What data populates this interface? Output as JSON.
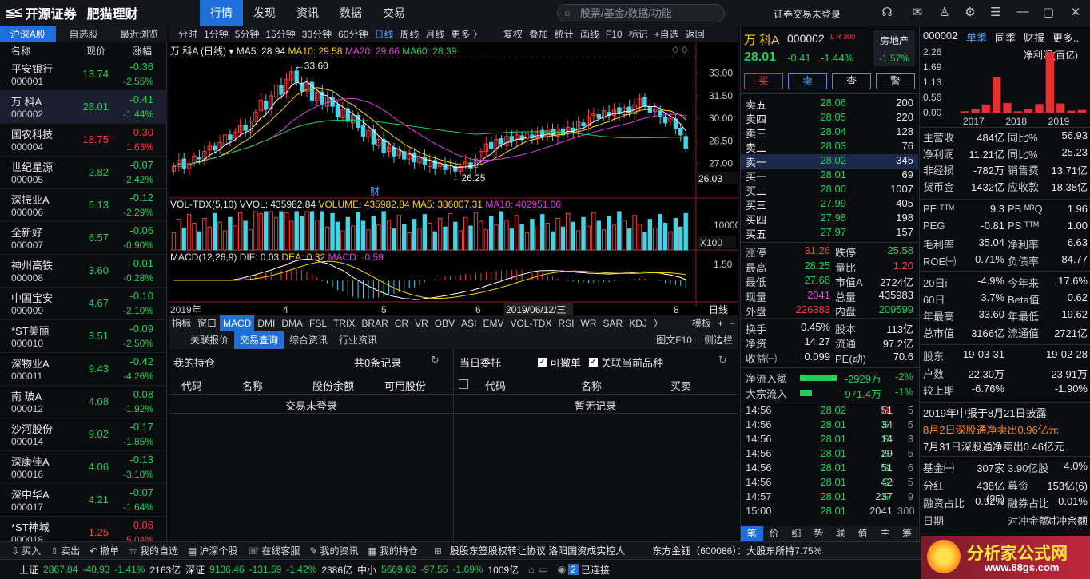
{
  "header": {
    "brand": "开源证券",
    "sub_brand": "肥猫理财",
    "nav": [
      "行情",
      "发现",
      "资讯",
      "数据",
      "交易"
    ],
    "active_nav": "行情",
    "search_placeholder": "股票/基金/数据/功能",
    "login_status": "证券交易未登录"
  },
  "left_panel": {
    "tabs": [
      "沪深A股",
      "自选股",
      "最近浏览"
    ],
    "columns": [
      "名称",
      "现价",
      "涨幅"
    ],
    "stocks": [
      {
        "name": "平安银行",
        "code": "000001",
        "price": "13.74",
        "change": "-0.36",
        "pct": "-2.55%"
      },
      {
        "name": "万 科A",
        "code": "000002",
        "price": "28.01",
        "change": "-0.41",
        "pct": "-1.44%"
      },
      {
        "name": "国农科技",
        "code": "000004",
        "price": "18.75",
        "change": "0.30",
        "pct": "1.63%"
      },
      {
        "name": "世纪星源",
        "code": "000005",
        "price": "2.82",
        "change": "-0.07",
        "pct": "-2.42%"
      },
      {
        "name": "深振业A",
        "code": "000006",
        "price": "5.13",
        "change": "-0.12",
        "pct": "-2.29%"
      },
      {
        "name": "全新好",
        "code": "000007",
        "price": "6.57",
        "change": "-0.06",
        "pct": "-0.90%"
      },
      {
        "name": "神州高铁",
        "code": "000008",
        "price": "3.60",
        "change": "-0.01",
        "pct": "-0.28%"
      },
      {
        "name": "中国宝安",
        "code": "000009",
        "price": "4.67",
        "change": "-0.10",
        "pct": "-2.10%"
      },
      {
        "name": "*ST美丽",
        "code": "000010",
        "price": "3.51",
        "change": "-0.09",
        "pct": "-2.50%"
      },
      {
        "name": "深物业A",
        "code": "000011",
        "price": "9.43",
        "change": "-0.42",
        "pct": "-4.26%"
      },
      {
        "name": "南 玻A",
        "code": "000012",
        "price": "4.08",
        "change": "-0.08",
        "pct": "-1.92%"
      },
      {
        "name": "沙河股份",
        "code": "000014",
        "price": "9.02",
        "change": "-0.17",
        "pct": "-1.85%"
      },
      {
        "name": "深康佳A",
        "code": "000016",
        "price": "4.06",
        "change": "-0.13",
        "pct": "-3.10%"
      },
      {
        "name": "深中华A",
        "code": "000017",
        "price": "4.21",
        "change": "-0.07",
        "pct": "-1.64%"
      },
      {
        "name": "*ST神城",
        "code": "000018",
        "price": "1.25",
        "change": "0.06",
        "pct": "5.04%"
      }
    ]
  },
  "chart_toolbar": {
    "periods": [
      "分时",
      "1分钟",
      "5分钟",
      "15分钟",
      "30分钟",
      "60分钟",
      "日线",
      "周线",
      "月线",
      "更多 〉"
    ],
    "active_period": "日线",
    "actions": [
      "复权",
      "叠加",
      "统计",
      "画线",
      "F10",
      "标记",
      "+自选",
      "返回"
    ]
  },
  "kline": {
    "title": "万 科A (日线)",
    "ma5": "MA5: 28.94",
    "ma10": "MA10: 29.58",
    "ma20": "MA20: 29.66",
    "ma60": "MA60: 28.39",
    "y_ticks": [
      "33.00",
      "31.50",
      "30.00",
      "28.50",
      "27.00"
    ],
    "last_label": "26.03",
    "high_label": "33.60",
    "low_label": "26.25",
    "fin_mark": "财",
    "vol_title": "VOL-TDX(5,10)",
    "vvol": "VVOL: 435982.84",
    "volume": "VOLUME: 435982.84",
    "vol_ma5": "MA5: 386007.31",
    "vol_ma10": "MA10: 402951.06",
    "vol_tick": "10000",
    "vol_unit": "X100",
    "macd_title": "MACD(12,26,9)",
    "dif": "DIF: 0.03",
    "dea": "DEA: 0.32",
    "macd": "MACD: -0.59",
    "macd_tick": "1.50",
    "x_labels": [
      "2019年",
      "4",
      "5",
      "6",
      "8"
    ],
    "cursor_date": "2019/06/12/三",
    "period_label": "日线"
  },
  "chart_data": {
    "type": "candlestick",
    "series_names": [
      "MA5",
      "MA10",
      "MA20",
      "MA60"
    ],
    "x_range": [
      "2019年",
      "8"
    ],
    "ylim": [
      25.5,
      34.2
    ],
    "y_ticks": [
      33.0,
      31.5,
      30.0,
      28.5,
      27.0
    ],
    "closes": [
      26.8,
      27.2,
      26.7,
      27.0,
      27.5,
      27.3,
      27.8,
      28.2,
      27.9,
      28.4,
      28.9,
      28.6,
      29.1,
      29.5,
      29.2,
      29.8,
      30.4,
      31.2,
      30.6,
      31.5,
      32.2,
      31.6,
      32.6,
      33.1,
      32.4,
      31.8,
      32.3,
      31.2,
      31.7,
      30.9,
      31.4,
      30.8,
      30.1,
      30.6,
      29.8,
      30.2,
      29.4,
      28.8,
      29.2,
      28.3,
      28.6,
      27.7,
      28.1,
      27.5,
      27.9,
      27.3,
      27.6,
      27.1,
      27.4,
      26.9,
      27.2,
      26.7,
      27.0,
      26.6,
      26.9,
      26.5,
      26.8,
      27.1,
      26.7,
      27.3,
      27.8,
      28.3,
      28.0,
      28.6,
      28.3,
      28.8,
      28.5,
      28.9,
      28.6,
      29.0,
      28.7,
      29.1,
      28.8,
      29.2,
      28.9,
      29.3,
      28.9,
      29.4,
      29.1,
      29.8,
      29.5,
      30.1,
      30.3,
      30.0,
      30.5,
      30.2,
      30.6,
      30.3,
      30.7,
      30.4,
      30.9,
      31.3,
      30.8,
      30.4,
      30.6,
      30.1,
      29.7,
      30.0,
      29.3,
      28.9,
      28.01
    ],
    "high": 33.6,
    "low": 26.25
  },
  "indicator_tabs": [
    "指标",
    "窗口",
    "MACD",
    "DMI",
    "DMA",
    "FSL",
    "TRIX",
    "BRAR",
    "CR",
    "VR",
    "OBV",
    "ASI",
    "EMV",
    "VOL-TDX",
    "RSI",
    "WR",
    "SAR",
    "KDJ",
    "〉",
    "模板",
    "+",
    "−"
  ],
  "active_indicator": "MACD",
  "bottom_tabs": [
    "关联报价",
    "交易查询",
    "综合资讯",
    "行业资讯"
  ],
  "active_bottom_tab": "交易查询",
  "bottom_tabs_right": [
    "图文F10",
    "侧边栏"
  ],
  "holdings": {
    "title": "我的持仓",
    "count": "共0条记录",
    "columns": [
      "代码",
      "名称",
      "股份余额",
      "可用股份"
    ],
    "empty": "交易未登录"
  },
  "entrust": {
    "title": "当日委托",
    "check1": "可撤单",
    "check2": "关联当前品种",
    "columns": [
      "代码",
      "名称",
      "买卖"
    ],
    "empty": "暂无记录"
  },
  "quote": {
    "name": "万 科A",
    "code": "000002",
    "tags": "L R 300",
    "sector": "房地产",
    "sector_pct": "-1.57%",
    "price": "28.01",
    "change": "-0.41",
    "pct": "-1.44%",
    "buttons": [
      "买",
      "卖",
      "查",
      "警"
    ],
    "asks": [
      {
        "label": "卖五",
        "price": "28.06",
        "vol": "200"
      },
      {
        "label": "卖四",
        "price": "28.05",
        "vol": "220"
      },
      {
        "label": "卖三",
        "price": "28.04",
        "vol": "128"
      },
      {
        "label": "卖二",
        "price": "28.03",
        "vol": "76"
      },
      {
        "label": "卖一",
        "price": "28.02",
        "vol": "345"
      }
    ],
    "bids": [
      {
        "label": "买一",
        "price": "28.01",
        "vol": "69"
      },
      {
        "label": "买二",
        "price": "28.00",
        "vol": "1007"
      },
      {
        "label": "买三",
        "price": "27.99",
        "vol": "405"
      },
      {
        "label": "买四",
        "price": "27.98",
        "vol": "198"
      },
      {
        "label": "买五",
        "price": "27.97",
        "vol": "157"
      }
    ],
    "stats": [
      {
        "l1": "涨停",
        "v1": "31.26",
        "c1": "red",
        "l2": "跌停",
        "v2": "25.58",
        "c2": "green"
      },
      {
        "l1": "最高",
        "v1": "28.25",
        "c1": "green",
        "l2": "量比",
        "v2": "1.20",
        "c2": "red"
      },
      {
        "l1": "最低",
        "v1": "27.68",
        "c1": "green",
        "l2": "市值A",
        "v2": "2724亿",
        "c2": "white"
      },
      {
        "l1": "现量",
        "v1": "2041",
        "c1": "mag",
        "l2": "总量",
        "v2": "435983",
        "c2": "white"
      },
      {
        "l1": "外盘",
        "v1": "226383",
        "c1": "red",
        "l2": "内盘",
        "v2": "209599",
        "c2": "green"
      },
      {
        "l1": "换手",
        "v1": "0.45%",
        "c1": "white",
        "l2": "股本",
        "v2": "113亿",
        "c2": "white"
      },
      {
        "l1": "净资",
        "v1": "14.27",
        "c1": "white",
        "l2": "流通",
        "v2": "97.2亿",
        "c2": "white"
      },
      {
        "l1": "收益㈠",
        "v1": "0.099",
        "c1": "white",
        "l2": "PE(动)",
        "v2": "70.6",
        "c2": "white"
      }
    ],
    "flows": [
      {
        "label": "净流入额",
        "value": "-2929万",
        "pct": "-2%",
        "bar": 0.62
      },
      {
        "label": "大宗流入",
        "value": "-971.4万",
        "pct": "-1%",
        "bar": 0.2
      }
    ],
    "ticks": [
      {
        "t": "14:56",
        "p": "28.02",
        "v": "51",
        "s": "B",
        "n": "5"
      },
      {
        "t": "14:56",
        "p": "28.01",
        "v": "34",
        "s": "S",
        "n": "5"
      },
      {
        "t": "14:56",
        "p": "28.01",
        "v": "14",
        "s": "S",
        "n": "3"
      },
      {
        "t": "14:56",
        "p": "28.01",
        "v": "29",
        "s": "S",
        "n": "5"
      },
      {
        "t": "14:56",
        "p": "28.01",
        "v": "51",
        "s": "S",
        "n": "6"
      },
      {
        "t": "14:56",
        "p": "28.01",
        "v": "42",
        "s": "S",
        "n": "5"
      },
      {
        "t": "14:57",
        "p": "28.01",
        "v": "237",
        "s": "S",
        "n": "9"
      },
      {
        "t": "15:00",
        "p": "28.01",
        "v": "2041",
        "s": "",
        "n": "300"
      }
    ],
    "bottom_tabs": [
      "笔",
      "价",
      "细",
      "势",
      "联",
      "值",
      "主",
      "筹"
    ]
  },
  "finance": {
    "code": "000002",
    "tabs": [
      "单季",
      "同季",
      "财报",
      "更多.."
    ],
    "chart_title": "净利润(百亿)",
    "y_ticks": [
      "2.26",
      "1.69",
      "1.13",
      "0.56",
      "0.00"
    ],
    "x_labels": [
      "2017",
      "2018",
      "2019"
    ],
    "bars": [
      0.05,
      0.12,
      0.3,
      1.32,
      0.36,
      0.05,
      0.15,
      0.32,
      2.26,
      0.34,
      0.07,
      0.1
    ],
    "rows1": [
      {
        "l1": "主营收",
        "v1": "484亿",
        "l2": "同比%",
        "v2": "56.93",
        "c2": "white"
      },
      {
        "l1": "净利润",
        "v1": "11.21亿",
        "l2": "同比%",
        "v2": "25.23",
        "c2": "white"
      },
      {
        "l1": "非经损",
        "v1": "-782万",
        "l2": "销售费",
        "v2": "13.71亿",
        "c2": "white"
      },
      {
        "l1": "货币金",
        "v1": "1432亿",
        "l2": "应收款",
        "v2": "18.38亿",
        "c2": "white"
      }
    ],
    "rows2": [
      {
        "l1": "PE ᵀᵀᴹ",
        "v1": "9.3",
        "l2": "PB ᴹᴿQ",
        "v2": "1.96"
      },
      {
        "l1": "PEG",
        "v1": "-0.81",
        "l2": "PS ᵀᵀᴹ",
        "v2": "1.00"
      },
      {
        "l1": "毛利率",
        "v1": "35.04",
        "l2": "净利率",
        "v2": "6.63"
      },
      {
        "l1": "ROE㈠",
        "v1": "0.71%",
        "l2": "负债率",
        "v2": "84.77"
      }
    ],
    "rows3": [
      {
        "l1": "20日i",
        "v1": "-4.9%",
        "l2": "今年来",
        "v2": "17.6%"
      },
      {
        "l1": "60日",
        "v1": "3.7%",
        "l2": "Beta值",
        "v2": "0.62"
      },
      {
        "l1": "年最高",
        "v1": "33.60",
        "l2": "年最低",
        "v2": "19.62"
      },
      {
        "l1": "总市值",
        "v1": "3166亿",
        "l2": "流通值",
        "v2": "2721亿"
      }
    ],
    "rows4": [
      {
        "l1": "股东",
        "v1": "19-03-31",
        "l2": "",
        "v2": "19-02-28"
      },
      {
        "l1": "户数",
        "v1": "22.30万",
        "l2": "",
        "v2": "23.91万"
      },
      {
        "l1": "较上期",
        "v1": "-6.76%",
        "l2": "",
        "v2": "-1.90%"
      }
    ],
    "news": [
      "2019年中报于8月21日披露",
      "8月2日深股通净卖出0.96亿元",
      "7月31日深股通净卖出0.46亿元"
    ],
    "rows5": [
      {
        "l1": "基金㈠",
        "v1": "307家",
        "l2": "3.90亿股",
        "v2": "4.0%"
      },
      {
        "l1": "分红",
        "v1": "438亿(25)",
        "l2": "募资",
        "v2": "153亿(6)"
      },
      {
        "l1": "融资占比",
        "v1": "0.92%",
        "l2": "融券占比",
        "v2": "0.01%"
      },
      {
        "l1": "日期",
        "v1": "",
        "l2": "对冲金额",
        "v2": "对冲余额"
      }
    ],
    "watermark": "分析家公式网",
    "watermark_url": "www.88gs.com"
  },
  "toolbar_bottom": [
    "买入",
    "卖出",
    "撤单",
    "我的自选",
    "沪深个股",
    "在线客服",
    "我的资讯",
    "我的持仓"
  ],
  "ticker_news": "股股东签股权转让协议 洛阳国资成实控人",
  "ticker_news2": "东方金钰（600086）：大股东所持7.75%",
  "status": {
    "sh_label": "上证",
    "sh_val": "2867.84",
    "sh_chg": "-40.93",
    "sh_pct": "-1.41%",
    "sh_amt": "2163亿",
    "sz_label": "深证",
    "sz_val": "9136.46",
    "sz_chg": "-131.59",
    "sz_pct": "-1.42%",
    "sz_amt": "2386亿",
    "zx_label": "中小",
    "zx_val": "5669.62",
    "zx_chg": "-97.55",
    "zx_pct": "-1.69%",
    "zx_amt": "1009亿",
    "conn": "已连接",
    "conn_count": "2"
  }
}
